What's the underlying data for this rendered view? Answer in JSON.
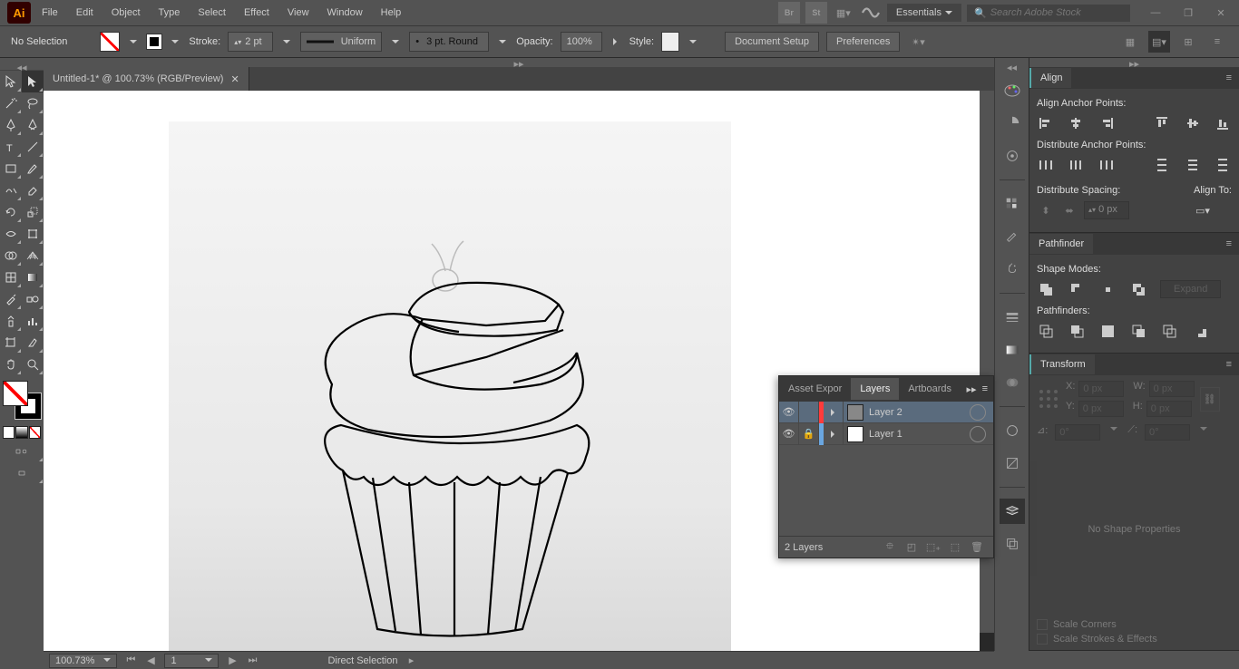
{
  "menu": {
    "items": [
      "File",
      "Edit",
      "Object",
      "Type",
      "Select",
      "Effect",
      "View",
      "Window",
      "Help"
    ]
  },
  "workspace": "Essentials",
  "search_placeholder": "Search Adobe Stock",
  "control": {
    "selection": "No Selection",
    "stroke_label": "Stroke:",
    "stroke_val": "2 pt",
    "profile": "Uniform",
    "brush": "3 pt. Round",
    "opacity_label": "Opacity:",
    "opacity_val": "100%",
    "style_label": "Style:",
    "doc_setup": "Document Setup",
    "prefs": "Preferences"
  },
  "doc_tab": "Untitled-1* @ 100.73% (RGB/Preview)",
  "layers_panel": {
    "tabs": [
      "Asset Expor",
      "Layers",
      "Artboards"
    ],
    "rows": [
      {
        "name": "Layer 2",
        "color": "#ff3b3b",
        "sel": true,
        "locked": false
      },
      {
        "name": "Layer 1",
        "color": "#6aa6e0",
        "sel": false,
        "locked": true
      }
    ],
    "footer": "2 Layers"
  },
  "align": {
    "title": "Align",
    "sec1": "Align Anchor Points:",
    "sec2": "Distribute Anchor Points:",
    "sec3": "Distribute Spacing:",
    "alignto": "Align To:",
    "spacing_val": "0 px"
  },
  "pathfinder": {
    "title": "Pathfinder",
    "sec1": "Shape Modes:",
    "sec2": "Pathfinders:",
    "expand": "Expand"
  },
  "transform": {
    "title": "Transform",
    "x": "X:",
    "y": "Y:",
    "w": "W:",
    "h": "H:",
    "xval": "0 px",
    "yval": "0 px",
    "wval": "0 px",
    "hval": "0 px",
    "angle": "0°",
    "shear": "0°",
    "noshape": "No Shape Properties",
    "scale_corners": "Scale Corners",
    "scale_strokes": "Scale Strokes & Effects"
  },
  "status": {
    "zoom": "100.73%",
    "page": "1",
    "tool": "Direct Selection"
  }
}
